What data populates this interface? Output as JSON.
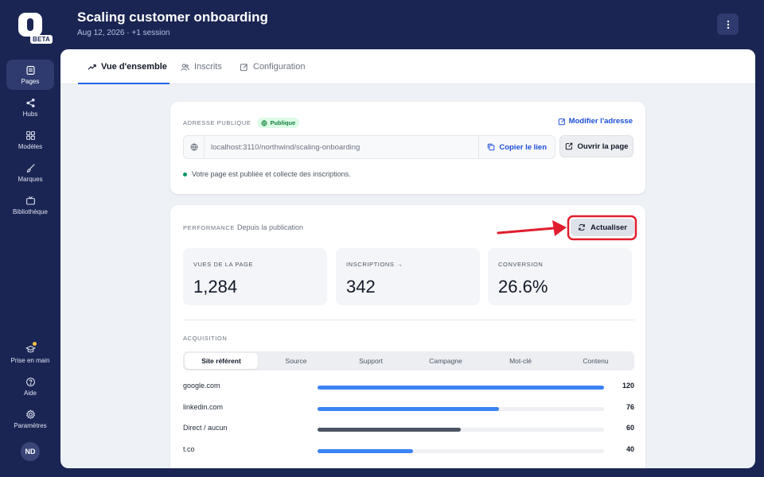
{
  "app": {
    "beta_label": "BETA"
  },
  "sidebar": {
    "items": [
      {
        "label": "Pages",
        "icon": "pages-icon"
      },
      {
        "label": "Hubs",
        "icon": "share-icon"
      },
      {
        "label": "Modèles",
        "icon": "grid-icon"
      },
      {
        "label": "Marques",
        "icon": "brush-icon"
      },
      {
        "label": "Bibliothèque",
        "icon": "tv-icon"
      }
    ],
    "bottom": [
      {
        "label": "Prise en main",
        "icon": "graduation-cap-icon"
      },
      {
        "label": "Aide",
        "icon": "help-icon"
      },
      {
        "label": "Paramètres",
        "icon": "gear-icon"
      }
    ],
    "avatar_initials": "ND"
  },
  "header": {
    "title": "Scaling customer onboarding",
    "subtitle": "Aug 12, 2026 · +1 session"
  },
  "tabs": [
    {
      "label": "Vue d'ensemble"
    },
    {
      "label": "Inscrits"
    },
    {
      "label": "Configuration"
    }
  ],
  "address": {
    "eyebrow": "ADRESSE PUBLIQUE",
    "badge": "Publique",
    "modify": "Modifier l'adresse",
    "url": "localhost:3110/northwind/scaling-onboarding",
    "copy": "Copier le lien",
    "open": "Ouvrir la page",
    "status": "Votre page est publiée et collecte des inscriptions."
  },
  "performance": {
    "eyebrow": "PERFORMANCE",
    "since": "Depuis la publication",
    "refresh": "Actualiser",
    "stats": [
      {
        "label": "VUES DE LA PAGE",
        "value": "1,284"
      },
      {
        "label": "INSCRIPTIONS →",
        "value": "342"
      },
      {
        "label": "CONVERSION",
        "value": "26.6%"
      }
    ],
    "acquisition_label": "ACQUISITION",
    "segments": [
      "Site référent",
      "Source",
      "Support",
      "Campagne",
      "Mot-clé",
      "Contenu"
    ],
    "referrers": [
      {
        "name": "google.com",
        "count": "120",
        "value": 120,
        "color": "#3b82f6"
      },
      {
        "name": "linkedin.com",
        "count": "76",
        "value": 76,
        "color": "#3b82f6"
      },
      {
        "name": "Direct / aucun",
        "count": "60",
        "value": 60,
        "color": "#4b5563"
      },
      {
        "name": "t.co",
        "count": "40",
        "value": 40,
        "color": "#3b82f6"
      }
    ],
    "max_value": 120
  },
  "colors": {
    "sidebar_bg": "#1b2553",
    "accent": "#2563eb",
    "annotation_red": "#e11d2e"
  }
}
